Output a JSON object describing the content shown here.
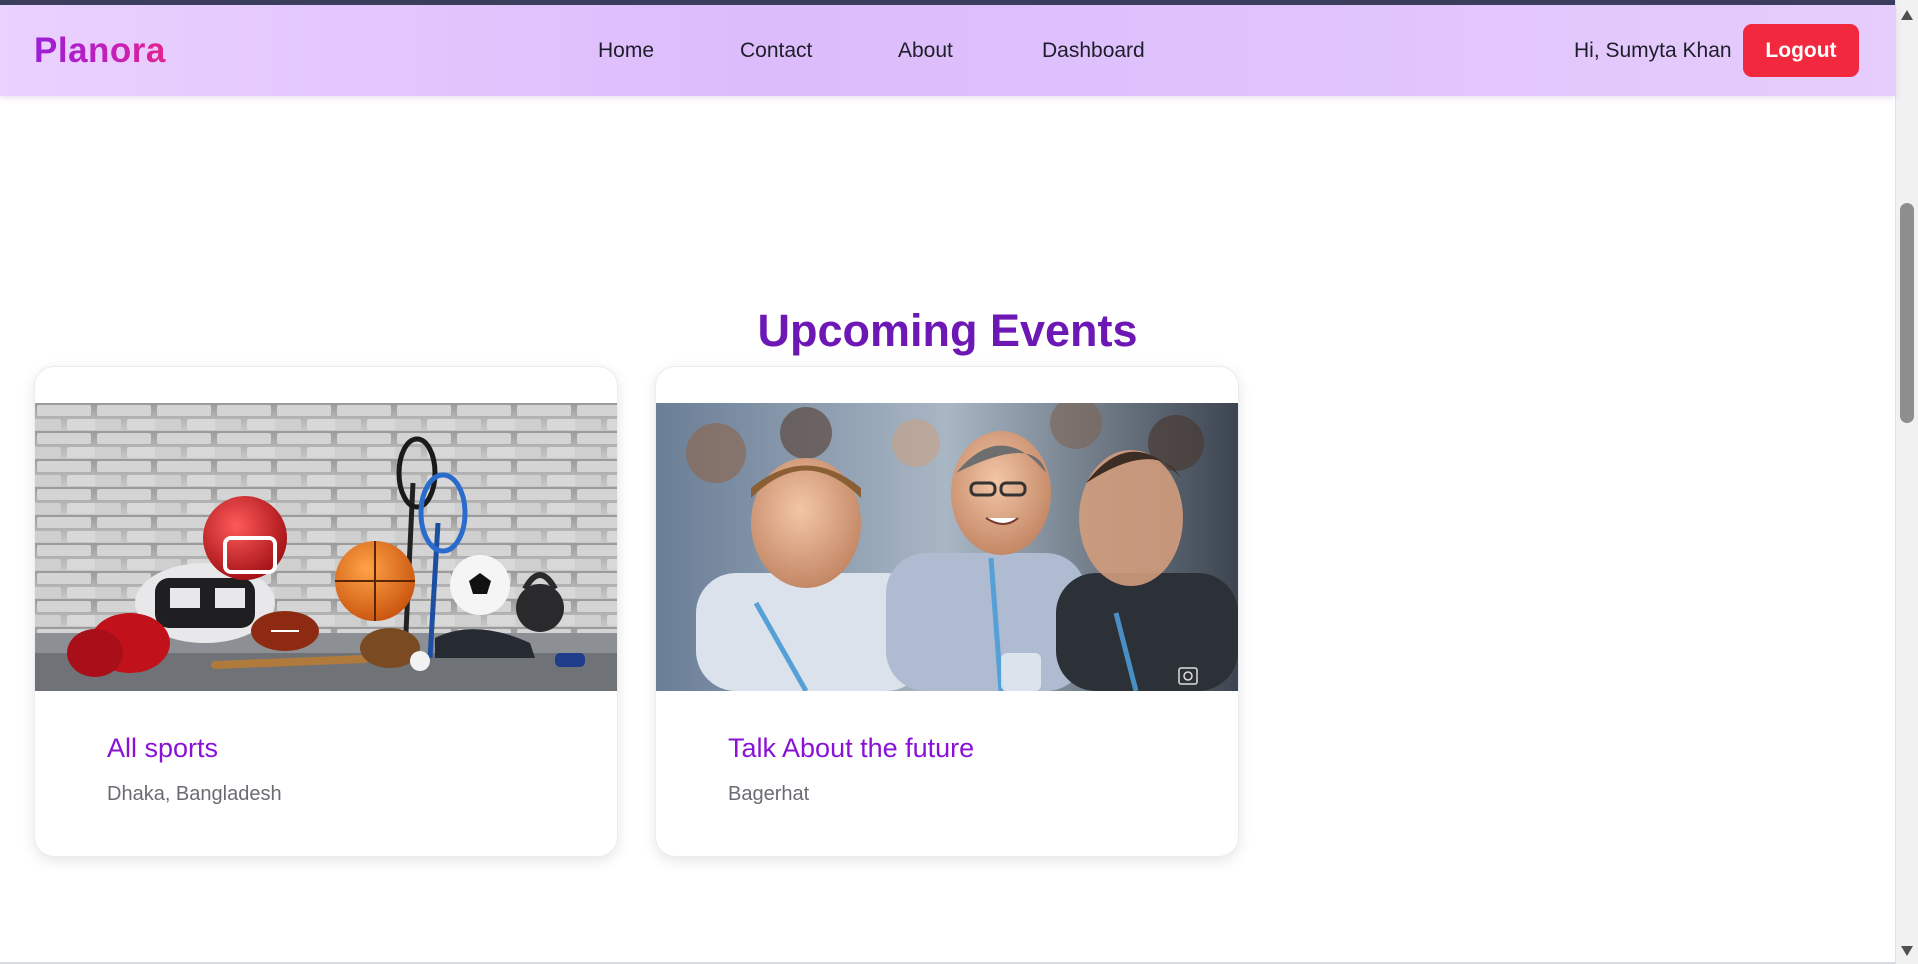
{
  "navbar": {
    "logo": "Planora",
    "links": [
      "Home",
      "Contact",
      "About",
      "Dashboard"
    ],
    "greeting": "Hi, Sumyta Khan",
    "logout_label": "Logout"
  },
  "main": {
    "section_title": "Upcoming Events",
    "events": [
      {
        "title": "All sports",
        "location": "Dhaka, Bangladesh"
      },
      {
        "title": "Talk About the future",
        "location": "Bagerhat"
      }
    ]
  },
  "colors": {
    "brand_purple": "#6d17b4",
    "card_title": "#8a12d6",
    "logout_red": "#f2283e",
    "navbar_bg": "#dcbcfb"
  }
}
